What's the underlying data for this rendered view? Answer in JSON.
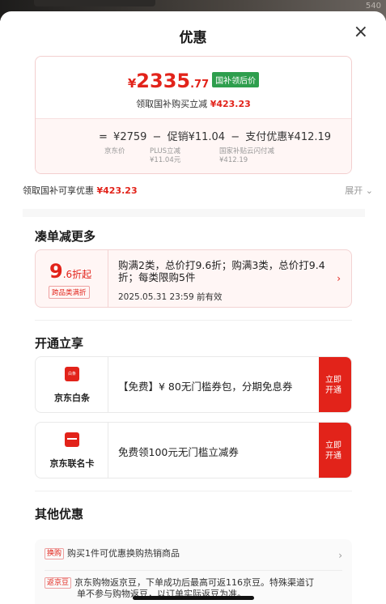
{
  "backdrop": {
    "corner_text": "540"
  },
  "sheet": {
    "title": "优惠",
    "close_glyph": "×"
  },
  "price_card": {
    "currency": "¥",
    "price_int": "2335",
    "price_dec": ".77",
    "tag": "国补领后价",
    "sub_prefix": "领取国补购买立减",
    "sub_amount": "¥423.23",
    "formula": {
      "eq": "=",
      "jd_price": "¥2759",
      "minus1": "−",
      "promo": "促销¥11.04",
      "minus2": "−",
      "pay": "支付优惠¥412.19"
    },
    "labels": {
      "jd": "京东价",
      "plus_line1": "PLUS立减",
      "plus_line2": "¥11.04元",
      "nat_line1": "国家补贴云闪付减",
      "nat_line2": "¥412.19"
    }
  },
  "national": {
    "text": "领取国补可享优惠",
    "amount": "¥423.23",
    "expand": "展开 ⌄"
  },
  "section1": {
    "title": "凑单减更多"
  },
  "promo": {
    "discount_int": "9",
    "discount_suffix": ".6折起",
    "chip": "跨品类满折",
    "desc": "购满2类，总价打9.6折；购满3类，总价打9.4折；每类限购5件",
    "date": "2025.05.31 23:59 前有效",
    "arrow": "›"
  },
  "section2": {
    "title": "开通立享"
  },
  "cards": [
    {
      "name": "京东白条",
      "icon_text": "白条",
      "text": "【免费】¥ 80无门槛券包，分期免息券",
      "btn1": "立即",
      "btn2": "开通"
    },
    {
      "name": "京东联名卡",
      "text": "免费领100元无门槛立减券",
      "btn1": "立即",
      "btn2": "开通"
    }
  ],
  "section3": {
    "title": "其他优惠"
  },
  "other": [
    {
      "tag": "换购",
      "text": "购买1件可优惠换购热销商品",
      "arrow": "›"
    },
    {
      "tag": "返京豆",
      "line1": "京东购物返京豆，下单成功后最高可返116京豆。特殊渠道订",
      "line2": "单不参与购物返豆，以订单实际返豆为准。"
    }
  ],
  "colors": {
    "accent": "#e2231a",
    "green_tag": "#2e9e4d"
  }
}
